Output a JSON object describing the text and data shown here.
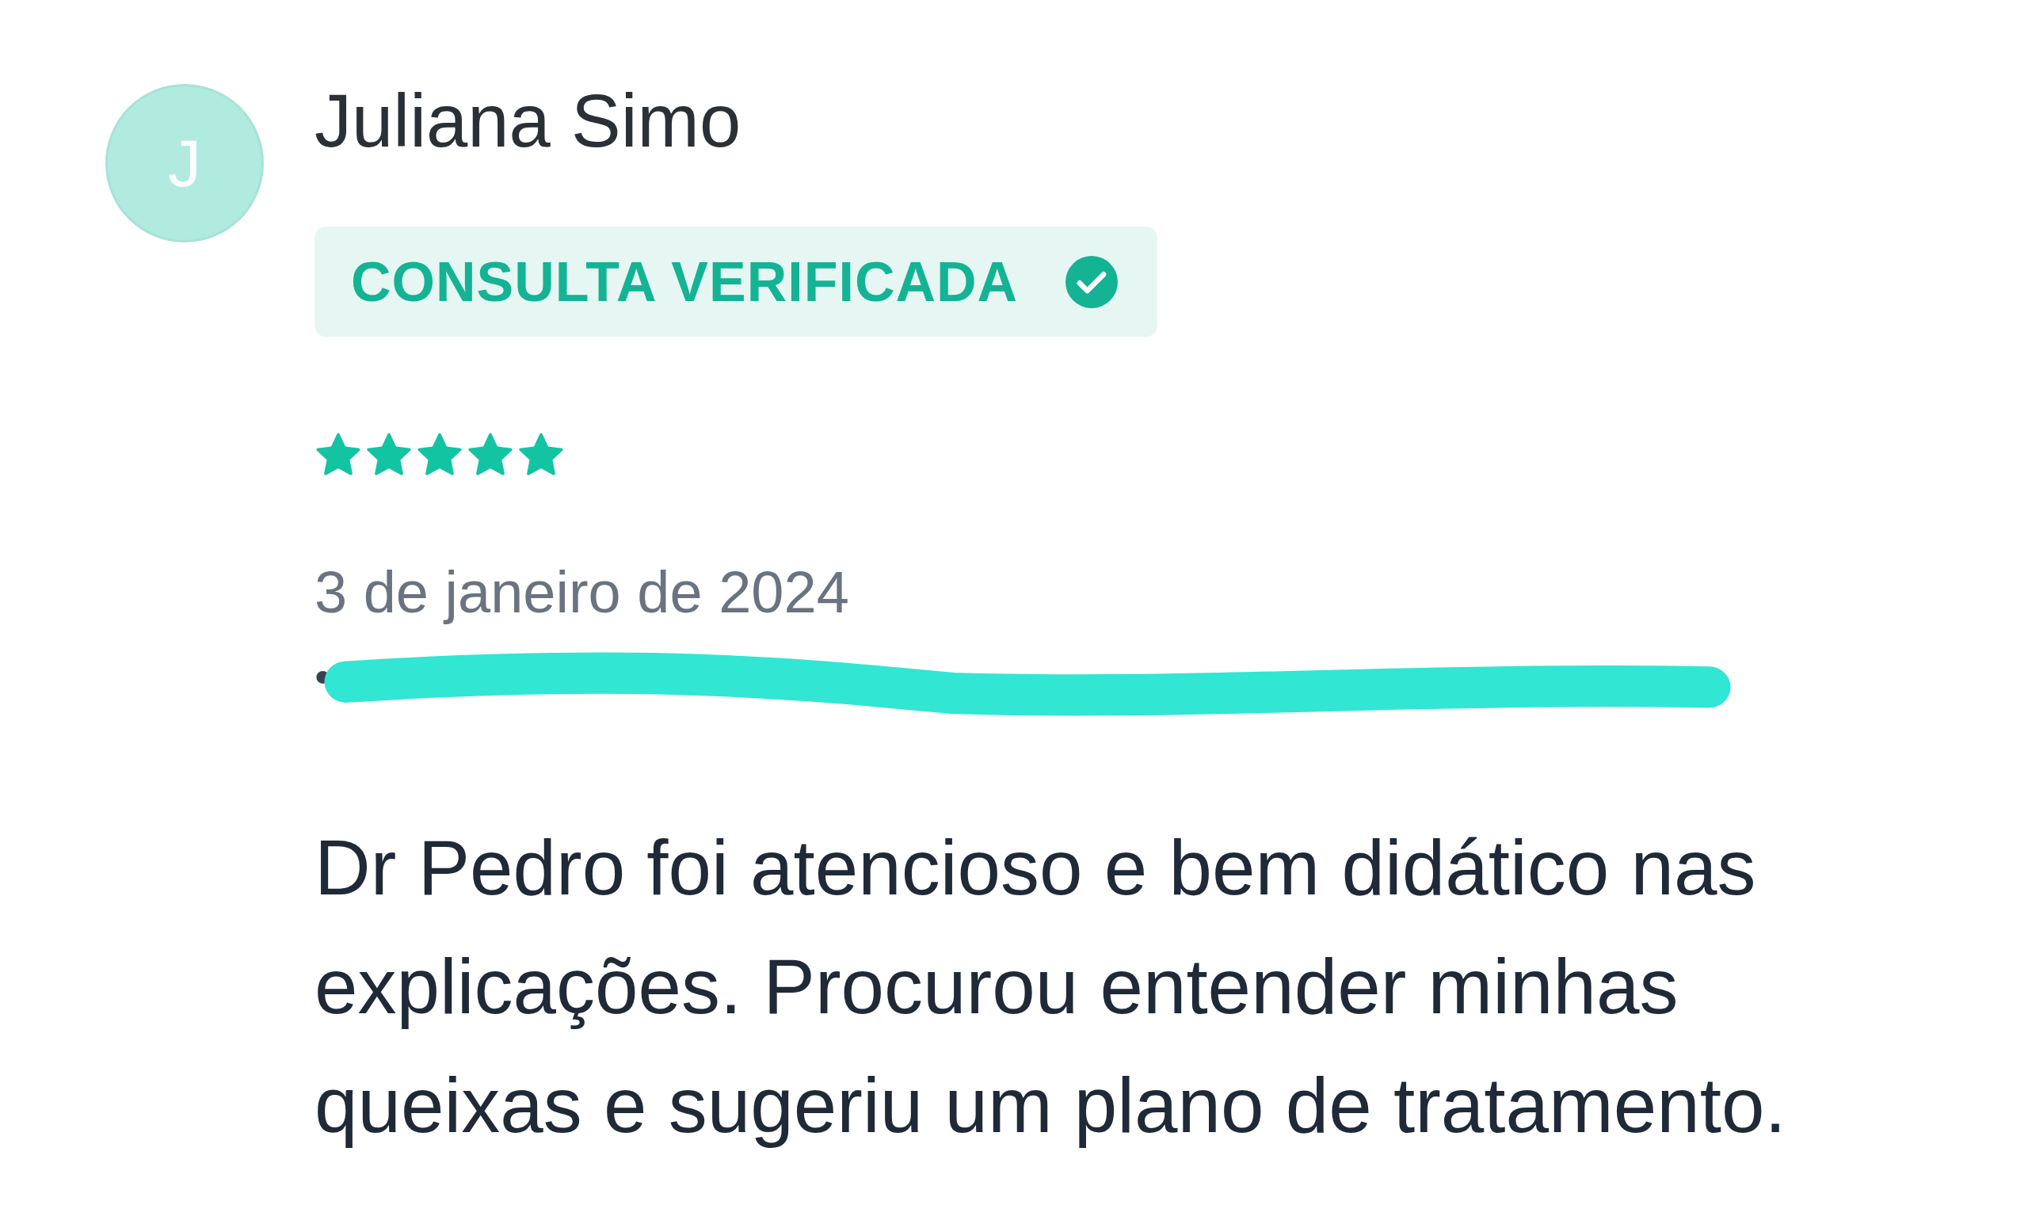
{
  "review": {
    "avatar": {
      "initial": "J"
    },
    "author": "Juliana Simo",
    "badge": {
      "label": "CONSULTA VERIFICADA",
      "verified": true
    },
    "stars": 5,
    "date": "3 de janeiro de 2024",
    "details": {
      "bullet": "•",
      "redacted": true
    },
    "text": "Dr Pedro foi atencioso e bem didático nas explicações. Procurou entender minhas queixas e sugeriu um plano de tratamento."
  }
}
